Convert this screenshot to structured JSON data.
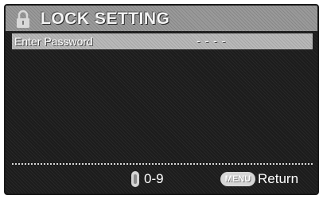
{
  "header": {
    "title": "LOCK SETTING",
    "icon": "lock-icon"
  },
  "menu": {
    "selected_item": {
      "label": "Enter Password",
      "value": "- - - -"
    }
  },
  "footer": {
    "digits_hint": "0-9",
    "digits_icon": "number-key-icon",
    "menu_key_label": "MENU",
    "return_label": "Return"
  },
  "colors": {
    "background": "#1c1c1c",
    "title_bar": "#9a9a9a",
    "highlight": "#b9b9b9",
    "text": "#ffffff"
  }
}
